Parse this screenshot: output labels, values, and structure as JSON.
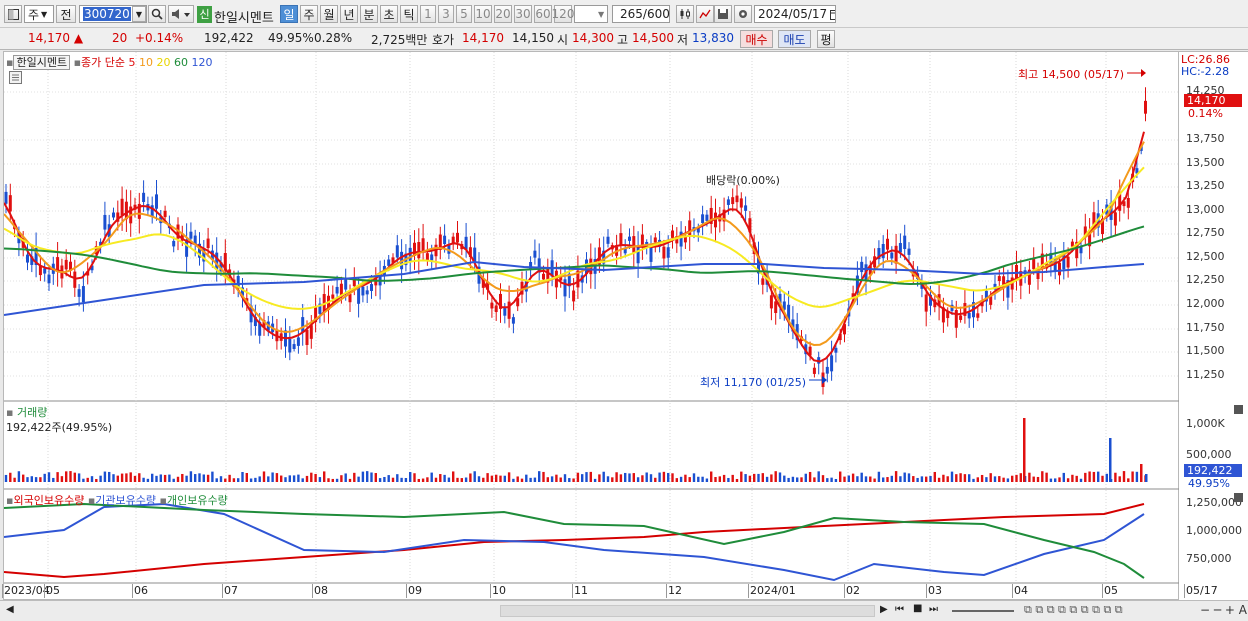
{
  "toolbar": {
    "type_dropdown": "주",
    "prev_label": "전",
    "code": "300720",
    "badge": "신",
    "stock_name": "한일시멘트",
    "periods": [
      "일",
      "주",
      "월",
      "년",
      "분",
      "초",
      "틱"
    ],
    "period_selected": "일",
    "intervals": [
      "1",
      "3",
      "5",
      "10",
      "20",
      "30",
      "60",
      "120"
    ],
    "count": "265",
    "count_total": "/600",
    "date": "2024/05/17"
  },
  "quote": {
    "price": "14,170",
    "arrow": "▲",
    "change": "20",
    "change_pct": "+0.14%",
    "volume": "192,422",
    "volume_pct": "49.95%",
    "turnover_pct": "0.28%",
    "amount": "2,725백만",
    "bid_label": "호가",
    "bid1": "14,170",
    "bid2": "14,150",
    "open_label": "시",
    "open": "14,300",
    "high_label": "고",
    "high": "14,500",
    "low_label": "저",
    "low": "13,830",
    "buy_label": "매수",
    "sell_label": "매도",
    "avg_label": "평"
  },
  "price_panel": {
    "name": "한일시멘트",
    "legend_title": "종가 단순",
    "ma": [
      "5",
      "10",
      "20",
      "60",
      "120"
    ],
    "ma_colors": [
      "#e01010",
      "#f39a1c",
      "#f7ea22",
      "#1f8c3a",
      "#2f55d4"
    ],
    "lc": "LC:26.86",
    "hc": "HC:-2.28",
    "high_note": "최고 14,500 (05/17)",
    "low_note": "최저 11,170 (01/25)",
    "dividend_note": "배당락(0.00%)",
    "last_price": "14,170",
    "last_pct": "0.14%",
    "y_ticks": [
      "14,250",
      "13,750",
      "13,500",
      "13,250",
      "13,000",
      "12,750",
      "12,500",
      "12,250",
      "12,000",
      "11,750",
      "11,500",
      "11,250"
    ]
  },
  "volume_panel": {
    "title": "거래량",
    "value": "192,422주(49.95%)",
    "y_ticks": [
      "1,000K",
      "500,000"
    ],
    "last_volume": "192,422",
    "last_pct": "49.95%"
  },
  "holding_panel": {
    "legend": [
      "외국인보유수량",
      "기관보유수량",
      "개인보유수량"
    ],
    "colors": [
      "#d40000",
      "#2f55d4",
      "#1f8c3a"
    ],
    "y_ticks": [
      "1,250,000",
      "1,000,000",
      "750,000"
    ]
  },
  "x_axis": [
    "2023/04",
    "05",
    "06",
    "07",
    "08",
    "09",
    "10",
    "11",
    "12",
    "2024/01",
    "02",
    "03",
    "04",
    "05",
    "05/17"
  ]
}
